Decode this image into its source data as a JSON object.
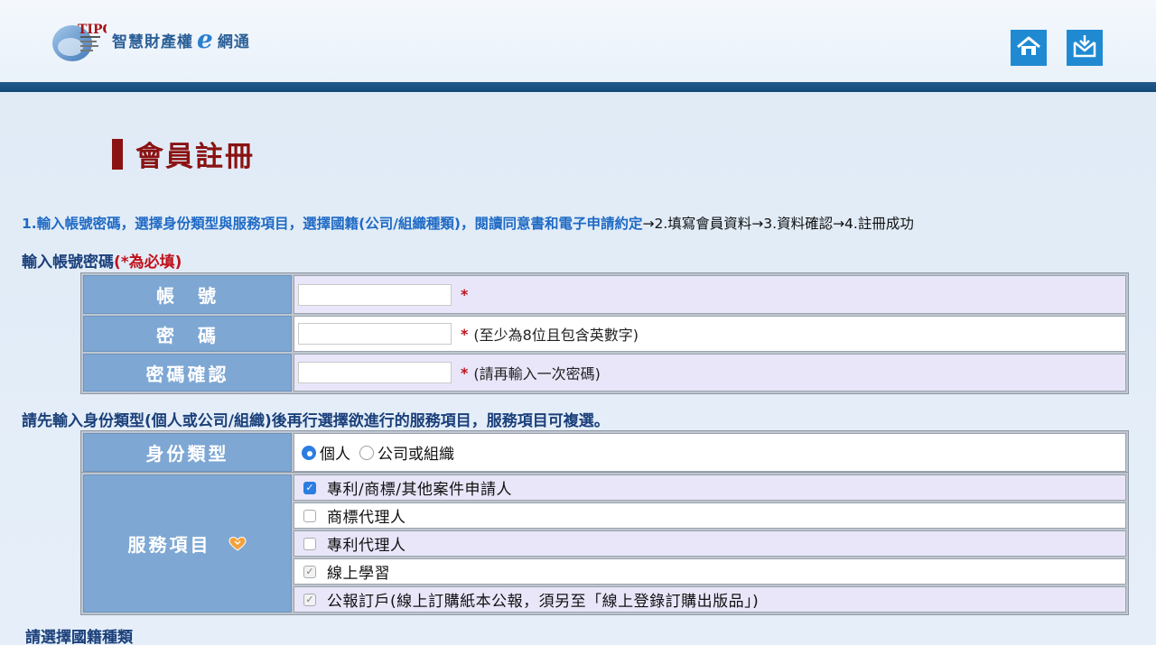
{
  "header": {
    "logo_mark_text": "TIPO",
    "logo_text_before": "智慧財產權",
    "logo_e": "e",
    "logo_text_after": "網通",
    "home_icon": "home-icon",
    "download_icon": "download-icon"
  },
  "page": {
    "title": "會員註冊"
  },
  "steps": {
    "current": "1.輸入帳號密碼，選擇身份類型與服務項目，選擇國籍(公司/組織種類)，閱讀同意書和電子申請約定",
    "rest": "→2.填寫會員資料→3.資料確認→4.註冊成功"
  },
  "account_section": {
    "label": "輸入帳號密碼",
    "required_note": "(*為必填)",
    "rows": [
      {
        "label": "帳　號",
        "value": "",
        "star": "*",
        "hint": ""
      },
      {
        "label": "密　碼",
        "value": "",
        "star": "*",
        "hint": "(至少為8位且包含英數字)"
      },
      {
        "label": "密碼確認",
        "value": "",
        "star": "*",
        "hint": "(請再輸入一次密碼)"
      }
    ]
  },
  "identity_section": {
    "label": "請先輸入身份類型(個人或公司/組織)後再行選擇欲進行的服務項目，服務項目可複選。",
    "identity_label": "身份類型",
    "options": [
      {
        "label": "個人",
        "selected": true
      },
      {
        "label": "公司或組織",
        "selected": false
      }
    ],
    "service_label": "服務項目",
    "services": [
      {
        "label": "專利/商標/其他案件申請人",
        "state": "checked"
      },
      {
        "label": "商標代理人",
        "state": "unchecked"
      },
      {
        "label": "專利代理人",
        "state": "unchecked"
      },
      {
        "label": "線上學習",
        "state": "disabled-checked"
      },
      {
        "label": "公報訂戶(線上訂購紙本公報，須另至「線上登錄訂購出版品」)",
        "state": "disabled-checked"
      }
    ],
    "heart_icon": "heart-icon"
  },
  "nationality_section": {
    "label": "請選擇國籍種類"
  },
  "colors": {
    "header_bar": "#1f5a8c",
    "title_red": "#8a1212",
    "step_blue": "#1f6ac4",
    "th_blue": "#7ea7d3",
    "lavender_row": "#e9e6fa",
    "required_red": "#c0121b",
    "icon_blue": "#1f8ad2"
  }
}
